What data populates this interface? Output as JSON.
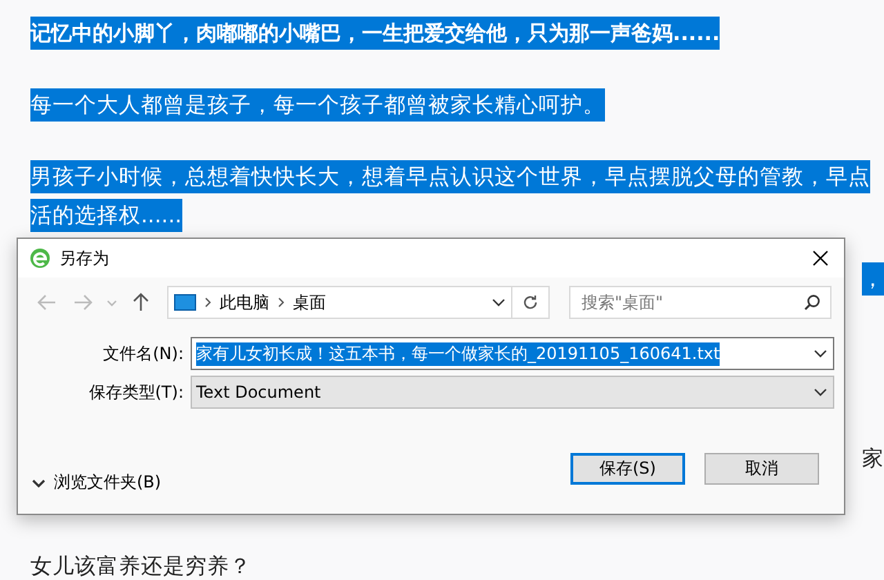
{
  "article": {
    "lines": [
      {
        "text": "记忆中的小脚丫，肉嘟嘟的小嘴巴，一生把爱交给他，只为那一声爸妈......",
        "bold": true,
        "selected": true,
        "kind": "line"
      },
      {
        "text": "每一个大人都曾是孩子，每一个孩子都曾被家长精心呵护。",
        "bold": false,
        "selected": true,
        "kind": "line"
      },
      {
        "text": "男孩子小时候，总想着快快长大，想着早点认识这个世界，早点摆脱父母的管教，早点",
        "bold": false,
        "selected": true,
        "kind": "line"
      },
      {
        "text": "活的选择权......",
        "bold": false,
        "selected": true,
        "kind": "line"
      },
      {
        "text": "，",
        "bold": false,
        "selected": true,
        "kind": "fragment"
      },
      {
        "text": "家",
        "bold": false,
        "selected": false,
        "kind": "fragment"
      },
      {
        "text": "女儿该富养还是穷养？",
        "bold": false,
        "selected": false,
        "kind": "line"
      }
    ]
  },
  "dialog": {
    "title": "另存为",
    "path": [
      "此电脑",
      "桌面"
    ],
    "search": {
      "placeholder": "搜索\"桌面\""
    },
    "filename": {
      "label": "文件名(N):",
      "value": "家有儿女初长成！这五本书，每一个做家长的_20191105_160641.txt",
      "selected": true
    },
    "filetype": {
      "label": "保存类型(T):",
      "value": "Text Document"
    },
    "browse": {
      "label": "浏览文件夹(B)",
      "expanded": false
    },
    "buttons": [
      {
        "label": "保存(S)",
        "default": true
      },
      {
        "label": "取消",
        "default": false
      }
    ]
  }
}
